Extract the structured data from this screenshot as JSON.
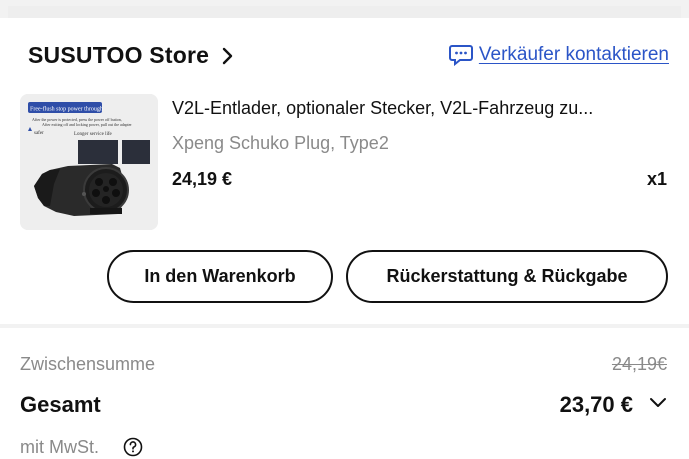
{
  "store": {
    "name": "SUSUTOO Store",
    "contact_label": "Verkäufer kontaktieren"
  },
  "item": {
    "title": "V2L-Entlader, optionaler Stecker, V2L-Fahrzeug zu...",
    "variant": "Xpeng Schuko Plug, Type2",
    "price": "24,19 €",
    "quantity": "x1",
    "image": {
      "banner_text": "Free-flush stop power through",
      "line1": "After the power is protected, press the power off button,",
      "line2": "After exiting off and locking power, pull out the adapter",
      "line3": "Longer service life",
      "side": "safer"
    }
  },
  "actions": {
    "add_to_cart": "In den Warenkorb",
    "refund": "Rückerstattung & Rückgabe"
  },
  "summary": {
    "subtotal_label": "Zwischensumme",
    "subtotal_value": "24,19€",
    "total_label": "Gesamt",
    "total_value": "23,70 €",
    "tax_label": "mit MwSt."
  },
  "colors": {
    "link": "#2b55c7",
    "text": "#111111",
    "muted": "#8a8a8a",
    "divider": "#f2f2f2"
  },
  "icons": [
    "chevron-right-icon",
    "chat-icon",
    "chevron-down-icon",
    "help-icon"
  ]
}
